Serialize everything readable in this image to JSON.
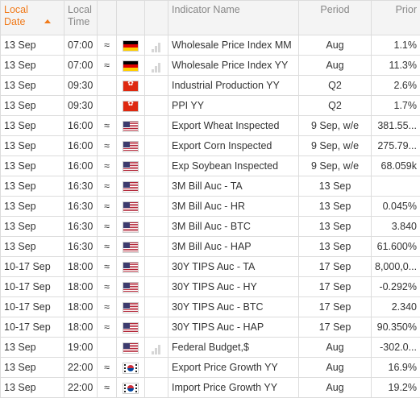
{
  "headers": {
    "local_date": "Local Date",
    "local_time": "Local Time",
    "indicator": "Indicator Name",
    "period": "Period",
    "prior": "Prior"
  },
  "rows": [
    {
      "date": "13 Sep",
      "time": "07:00",
      "freq": "≈",
      "flag": "germany-flag",
      "bars": true,
      "indicator": "Wholesale Price Index MM",
      "period": "Aug",
      "prior": "1.1%"
    },
    {
      "date": "13 Sep",
      "time": "07:00",
      "freq": "≈",
      "flag": "germany-flag",
      "bars": true,
      "indicator": "Wholesale Price Index YY",
      "period": "Aug",
      "prior": "11.3%"
    },
    {
      "date": "13 Sep",
      "time": "09:30",
      "freq": "",
      "flag": "hong-kong-flag",
      "bars": false,
      "indicator": "Industrial Production YY",
      "period": "Q2",
      "prior": "2.6%"
    },
    {
      "date": "13 Sep",
      "time": "09:30",
      "freq": "",
      "flag": "hong-kong-flag",
      "bars": false,
      "indicator": "PPI YY",
      "period": "Q2",
      "prior": "1.7%"
    },
    {
      "date": "13 Sep",
      "time": "16:00",
      "freq": "≈",
      "flag": "usa-flag",
      "bars": false,
      "indicator": "Export Wheat Inspected",
      "period": "9 Sep, w/e",
      "prior": "381.55..."
    },
    {
      "date": "13 Sep",
      "time": "16:00",
      "freq": "≈",
      "flag": "usa-flag",
      "bars": false,
      "indicator": "Export Corn Inspected",
      "period": "9 Sep, w/e",
      "prior": "275.79..."
    },
    {
      "date": "13 Sep",
      "time": "16:00",
      "freq": "≈",
      "flag": "usa-flag",
      "bars": false,
      "indicator": "Exp Soybean Inspected",
      "period": "9 Sep, w/e",
      "prior": "68.059k"
    },
    {
      "date": "13 Sep",
      "time": "16:30",
      "freq": "≈",
      "flag": "usa-flag",
      "bars": false,
      "indicator": "3M Bill Auc - TA",
      "period": "13 Sep",
      "prior": ""
    },
    {
      "date": "13 Sep",
      "time": "16:30",
      "freq": "≈",
      "flag": "usa-flag",
      "bars": false,
      "indicator": "3M Bill Auc - HR",
      "period": "13 Sep",
      "prior": "0.045%"
    },
    {
      "date": "13 Sep",
      "time": "16:30",
      "freq": "≈",
      "flag": "usa-flag",
      "bars": false,
      "indicator": "3M Bill Auc - BTC",
      "period": "13 Sep",
      "prior": "3.840"
    },
    {
      "date": "13 Sep",
      "time": "16:30",
      "freq": "≈",
      "flag": "usa-flag",
      "bars": false,
      "indicator": "3M Bill Auc - HAP",
      "period": "13 Sep",
      "prior": "61.600%"
    },
    {
      "date": "10-17 Sep",
      "time": "18:00",
      "freq": "≈",
      "flag": "usa-flag",
      "bars": false,
      "indicator": "30Y TIPS Auc - TA",
      "period": "17 Sep",
      "prior": "8,000,0..."
    },
    {
      "date": "10-17 Sep",
      "time": "18:00",
      "freq": "≈",
      "flag": "usa-flag",
      "bars": false,
      "indicator": "30Y TIPS Auc - HY",
      "period": "17 Sep",
      "prior": "-0.292%"
    },
    {
      "date": "10-17 Sep",
      "time": "18:00",
      "freq": "≈",
      "flag": "usa-flag",
      "bars": false,
      "indicator": "30Y TIPS Auc - BTC",
      "period": "17 Sep",
      "prior": "2.340"
    },
    {
      "date": "10-17 Sep",
      "time": "18:00",
      "freq": "≈",
      "flag": "usa-flag",
      "bars": false,
      "indicator": "30Y TIPS Auc - HAP",
      "period": "17 Sep",
      "prior": "90.350%"
    },
    {
      "date": "13 Sep",
      "time": "19:00",
      "freq": "",
      "flag": "usa-flag",
      "bars": true,
      "indicator": "Federal Budget,$",
      "period": "Aug",
      "prior": "-302.0..."
    },
    {
      "date": "13 Sep",
      "time": "22:00",
      "freq": "≈",
      "flag": "south-korea-flag",
      "bars": false,
      "indicator": "Export Price Growth YY",
      "period": "Aug",
      "prior": "16.9%"
    },
    {
      "date": "13 Sep",
      "time": "22:00",
      "freq": "≈",
      "flag": "south-korea-flag",
      "bars": false,
      "indicator": "Import Price Growth YY",
      "period": "Aug",
      "prior": "19.2%"
    }
  ],
  "colors": {
    "sorted_header": "#f07a1a",
    "header_bg": "#f4f4f4",
    "border": "#dcdcdc"
  }
}
